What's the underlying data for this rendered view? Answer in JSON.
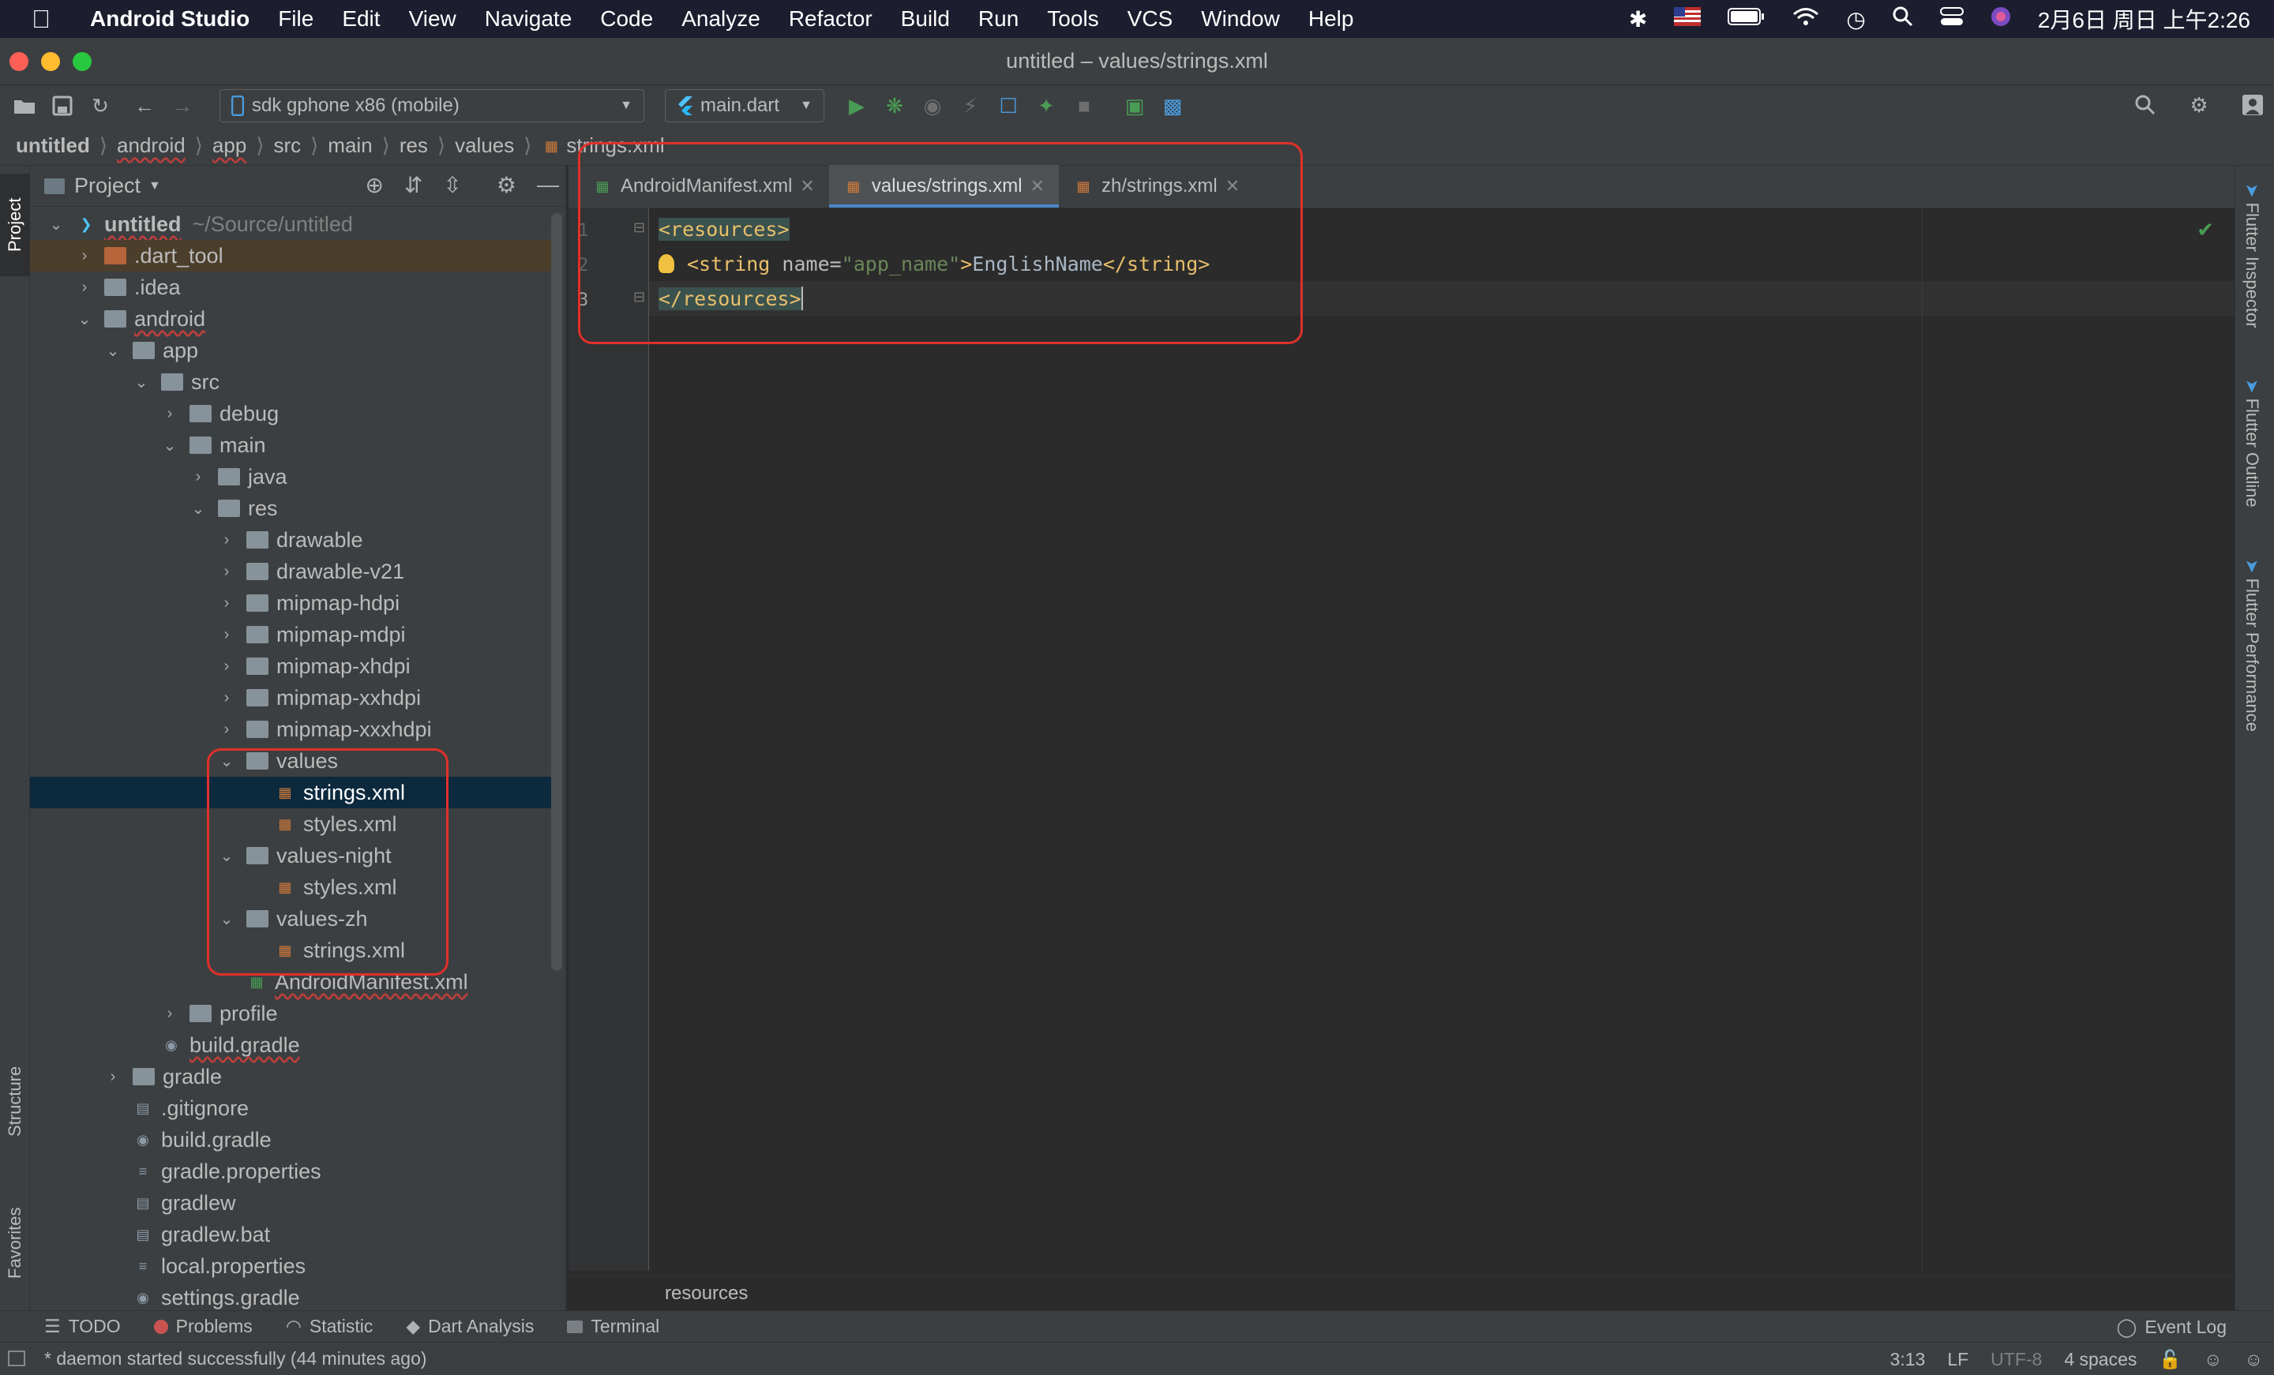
{
  "menubar": {
    "app": "Android Studio",
    "items": [
      "File",
      "Edit",
      "View",
      "Navigate",
      "Code",
      "Analyze",
      "Refactor",
      "Build",
      "Run",
      "Tools",
      "VCS",
      "Window",
      "Help"
    ],
    "clock": "2月6日 周日 上午2:26"
  },
  "window": {
    "title": "untitled – values/strings.xml"
  },
  "toolbar": {
    "device": "sdk gphone x86 (mobile)",
    "run_config": "main.dart"
  },
  "breadcrumb": [
    "untitled",
    "android",
    "app",
    "src",
    "main",
    "res",
    "values",
    "strings.xml"
  ],
  "left_tabs": {
    "project": "Project",
    "structure": "Structure",
    "favorites": "Favorites"
  },
  "project_panel": {
    "title": "Project",
    "tree": [
      {
        "label": "untitled",
        "suffix": "~/Source/untitled",
        "depth": 0,
        "type": "project",
        "open": true
      },
      {
        "label": ".dart_tool",
        "depth": 1,
        "type": "folder-orange",
        "open": false,
        "highlight": true
      },
      {
        "label": ".idea",
        "depth": 1,
        "type": "folder",
        "open": false
      },
      {
        "label": "android",
        "depth": 1,
        "type": "folder",
        "open": true
      },
      {
        "label": "app",
        "depth": 2,
        "type": "folder",
        "open": true
      },
      {
        "label": "src",
        "depth": 3,
        "type": "folder",
        "open": true
      },
      {
        "label": "debug",
        "depth": 4,
        "type": "folder",
        "open": false
      },
      {
        "label": "main",
        "depth": 4,
        "type": "folder",
        "open": true
      },
      {
        "label": "java",
        "depth": 5,
        "type": "folder",
        "open": false
      },
      {
        "label": "res",
        "depth": 5,
        "type": "folder",
        "open": true
      },
      {
        "label": "drawable",
        "depth": 6,
        "type": "folder",
        "open": false
      },
      {
        "label": "drawable-v21",
        "depth": 6,
        "type": "folder",
        "open": false
      },
      {
        "label": "mipmap-hdpi",
        "depth": 6,
        "type": "folder",
        "open": false
      },
      {
        "label": "mipmap-mdpi",
        "depth": 6,
        "type": "folder",
        "open": false
      },
      {
        "label": "mipmap-xhdpi",
        "depth": 6,
        "type": "folder",
        "open": false
      },
      {
        "label": "mipmap-xxhdpi",
        "depth": 6,
        "type": "folder",
        "open": false
      },
      {
        "label": "mipmap-xxxhdpi",
        "depth": 6,
        "type": "folder",
        "open": false
      },
      {
        "label": "values",
        "depth": 6,
        "type": "folder",
        "open": true
      },
      {
        "label": "strings.xml",
        "depth": 7,
        "type": "xml",
        "selected": true
      },
      {
        "label": "styles.xml",
        "depth": 7,
        "type": "xml"
      },
      {
        "label": "values-night",
        "depth": 6,
        "type": "folder",
        "open": true
      },
      {
        "label": "styles.xml",
        "depth": 7,
        "type": "xml"
      },
      {
        "label": "values-zh",
        "depth": 6,
        "type": "folder",
        "open": true
      },
      {
        "label": "strings.xml",
        "depth": 7,
        "type": "xml"
      },
      {
        "label": "AndroidManifest.xml",
        "depth": 6,
        "type": "manifest"
      },
      {
        "label": "profile",
        "depth": 4,
        "type": "folder",
        "open": false
      },
      {
        "label": "build.gradle",
        "depth": 3,
        "type": "gradle"
      },
      {
        "label": "gradle",
        "depth": 2,
        "type": "folder",
        "open": false
      },
      {
        "label": ".gitignore",
        "depth": 2,
        "type": "file"
      },
      {
        "label": "build.gradle",
        "depth": 2,
        "type": "gradle"
      },
      {
        "label": "gradle.properties",
        "depth": 2,
        "type": "props"
      },
      {
        "label": "gradlew",
        "depth": 2,
        "type": "file"
      },
      {
        "label": "gradlew.bat",
        "depth": 2,
        "type": "file"
      },
      {
        "label": "local.properties",
        "depth": 2,
        "type": "props"
      },
      {
        "label": "settings.gradle",
        "depth": 2,
        "type": "gradle"
      }
    ]
  },
  "editor": {
    "tabs": [
      {
        "label": "AndroidManifest.xml",
        "active": false
      },
      {
        "label": "values/strings.xml",
        "active": true
      },
      {
        "label": "zh/strings.xml",
        "active": false
      }
    ],
    "line_numbers": [
      "1",
      "2",
      "3"
    ],
    "line1": {
      "open_tag": "<resources>"
    },
    "line2": {
      "tag_open": "<string ",
      "attr": "name=",
      "val": "\"app_name\"",
      "close_bracket": ">",
      "text": "EnglishName",
      "tag_close": "</string>"
    },
    "line3": {
      "close_tag": "</resources>"
    },
    "bottom_breadcrumb": "resources"
  },
  "right_tabs": [
    "Flutter Inspector",
    "Flutter Outline",
    "Flutter Performance"
  ],
  "bottom_tools": [
    "TODO",
    "Problems",
    "Statistic",
    "Dart Analysis",
    "Terminal"
  ],
  "event_log": "Event Log",
  "status": {
    "message": "* daemon started successfully (44 minutes ago)",
    "position": "3:13",
    "line_sep": "LF",
    "encoding": "UTF-8",
    "indent": "4 spaces"
  },
  "colors": {
    "accent": "#4a88c7",
    "annotation": "#e0302a",
    "selection": "#0d293e"
  }
}
